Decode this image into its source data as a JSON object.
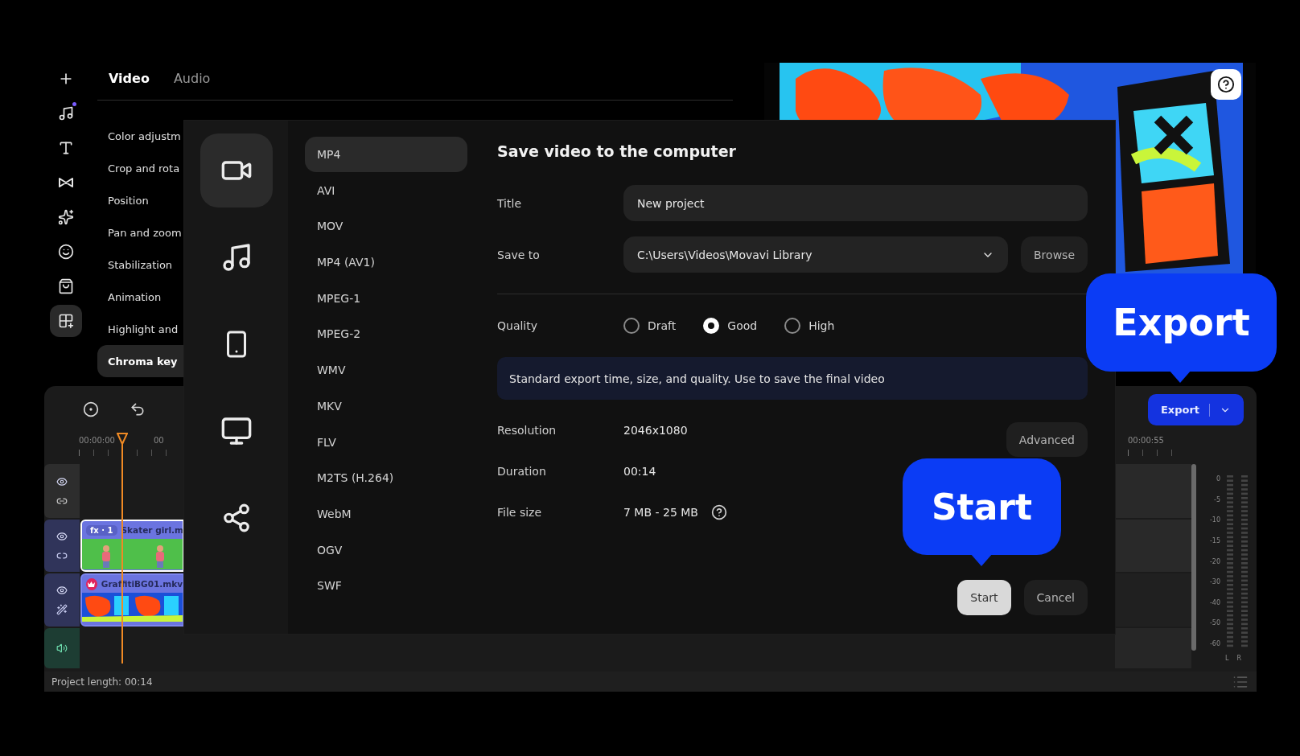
{
  "rail": [
    {
      "kind": "add",
      "selected": false,
      "notified": false
    },
    {
      "kind": "music",
      "selected": false,
      "notified": true
    },
    {
      "kind": "text",
      "selected": false,
      "notified": false
    },
    {
      "kind": "transitions",
      "selected": false,
      "notified": false
    },
    {
      "kind": "effects",
      "selected": false,
      "notified": false
    },
    {
      "kind": "stickers",
      "selected": false,
      "notified": false
    },
    {
      "kind": "store",
      "selected": false,
      "notified": false
    },
    {
      "kind": "apps",
      "selected": true,
      "notified": false
    }
  ],
  "editor": {
    "tabs": [
      {
        "label": "Video",
        "selected": true
      },
      {
        "label": "Audio",
        "selected": false
      }
    ],
    "items": [
      {
        "label": "Color adjustm",
        "selected": false
      },
      {
        "label": "Crop and rota",
        "selected": false
      },
      {
        "label": "Position",
        "selected": false
      },
      {
        "label": "Pan and zoom",
        "selected": false
      },
      {
        "label": "Stabilization",
        "selected": false
      },
      {
        "label": "Animation",
        "selected": false
      },
      {
        "label": "Highlight and",
        "selected": false
      },
      {
        "label": "Chroma key",
        "selected": true
      }
    ]
  },
  "dialog": {
    "categories": [
      {
        "kind": "video",
        "selected": true
      },
      {
        "kind": "audio",
        "selected": false
      },
      {
        "kind": "device",
        "selected": false
      },
      {
        "kind": "tv",
        "selected": false
      },
      {
        "kind": "share",
        "selected": false
      }
    ],
    "formats": [
      {
        "label": "MP4",
        "selected": true
      },
      {
        "label": "AVI",
        "selected": false
      },
      {
        "label": "MOV",
        "selected": false
      },
      {
        "label": "MP4 (AV1)",
        "selected": false
      },
      {
        "label": "MPEG-1",
        "selected": false
      },
      {
        "label": "MPEG-2",
        "selected": false
      },
      {
        "label": "WMV",
        "selected": false
      },
      {
        "label": "MKV",
        "selected": false
      },
      {
        "label": "FLV",
        "selected": false
      },
      {
        "label": "M2TS (H.264)",
        "selected": false
      },
      {
        "label": "WebM",
        "selected": false
      },
      {
        "label": "OGV",
        "selected": false
      },
      {
        "label": "SWF",
        "selected": false
      }
    ],
    "heading": "Save video to the computer",
    "title_label": "Title",
    "title_value": "New project",
    "save_label": "Save to",
    "save_value": "C:\\Users\\Videos\\Movavi Library",
    "browse": "Browse",
    "quality_label": "Quality",
    "quality": [
      {
        "label": "Draft",
        "selected": false
      },
      {
        "label": "Good",
        "selected": true
      },
      {
        "label": "High",
        "selected": false
      }
    ],
    "info": "Standard export time, size, and quality. Use to save the final video",
    "details": [
      {
        "label": "Resolution",
        "value": "2046x1080",
        "help": false
      },
      {
        "label": "Duration",
        "value": "00:14",
        "help": false
      },
      {
        "label": "File size",
        "value": "7 MB - 25 MB",
        "help": true
      }
    ],
    "advanced": "Advanced",
    "start": "Start",
    "cancel": "Cancel"
  },
  "timeline": {
    "ruler_start": "00:00:00",
    "ruler_cut": "00",
    "ruler_end": "00:00:55",
    "export": "Export",
    "tracks": [
      {
        "kind": "empty"
      },
      {
        "kind": "overlay",
        "badge": "fx · 1",
        "clip": "Skater girl.m"
      },
      {
        "kind": "main",
        "clip": "GraffitiBG01.mkv"
      },
      {
        "kind": "audio"
      }
    ],
    "meter_labels": [
      "0",
      "-5",
      "-10",
      "-15",
      "-20",
      "-30",
      "-40",
      "-50",
      "-60"
    ],
    "channels": [
      "L",
      "R"
    ],
    "project_length": "Project length: 00:14"
  },
  "callouts": [
    {
      "label": "Export"
    },
    {
      "label": "Start"
    }
  ]
}
